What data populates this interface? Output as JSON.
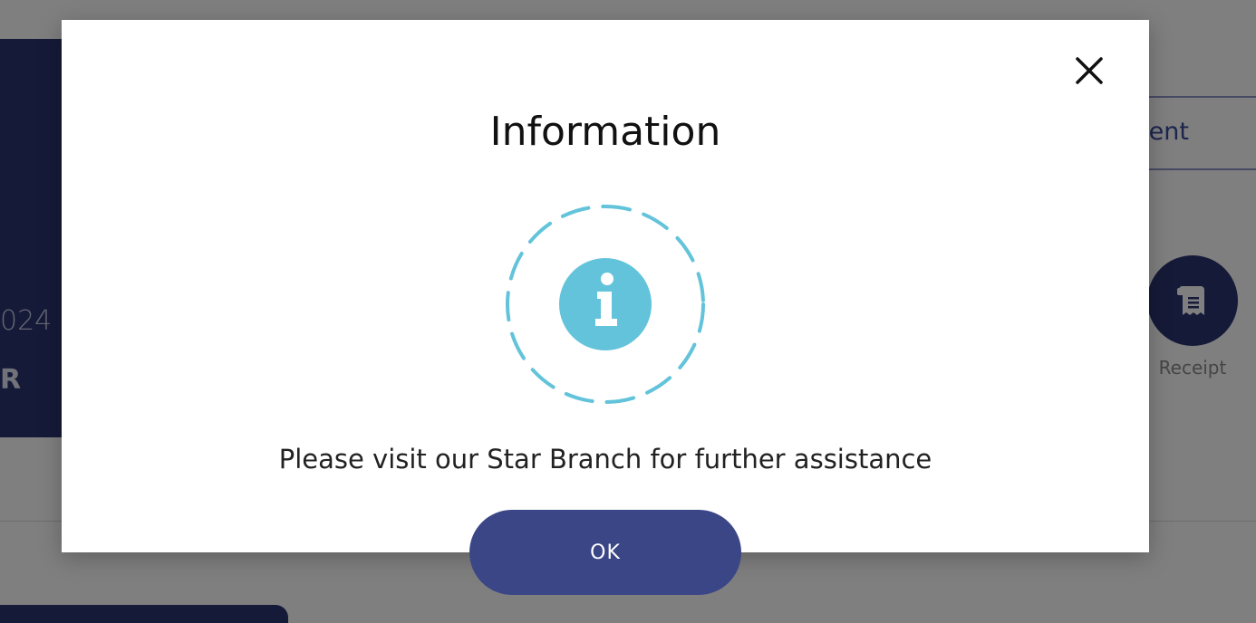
{
  "background": {
    "card": {
      "date_fragment": "024",
      "currency_fragment": "R"
    },
    "tab": {
      "label_fragment": "nent"
    },
    "receipt": {
      "label": "Receipt",
      "icon": "receipt-icon"
    }
  },
  "modal": {
    "title": "Information",
    "icon": "info-icon",
    "message": "Please visit our Star Branch for further assistance",
    "ok_label": "OK",
    "close_icon": "close-icon"
  },
  "colors": {
    "brand_navy": "#2b3470",
    "button": "#3b4687",
    "info_accent": "#62c3da",
    "overlay": "rgba(0,0,0,0.5)"
  }
}
